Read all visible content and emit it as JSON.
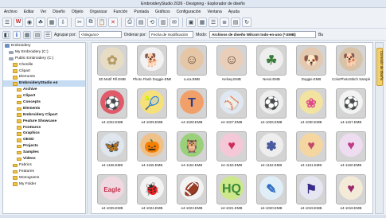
{
  "window": {
    "title": "EmbroideryStudio 2026 - Designing - Explorador de diseño"
  },
  "menu": [
    "Archivo",
    "Editar",
    "Ver",
    "Diseño",
    "Objeto",
    "Organizar",
    "Función",
    "Puntada",
    "Gráficos",
    "Configuración",
    "Ventana",
    "Ayuda"
  ],
  "toolbar2": {
    "group_label": "Agrupar por:",
    "group_value": "<Ninguno>",
    "order_label": "Ordenar por:",
    "order_value": "Fecha de modificación",
    "mode_label": "Modo:",
    "filter_value": "Archivos de diseño Wilcom todo-en-uno (*.EMB)",
    "size_label": "Bu"
  },
  "tree": [
    {
      "label": "Embroidery",
      "indent": 0,
      "icon": "lib",
      "bold": false,
      "selected": false
    },
    {
      "label": "My Embroidery (C:)",
      "indent": 1,
      "icon": "drive",
      "bold": false,
      "selected": false
    },
    {
      "label": "Public Embroidery (C:)",
      "indent": 1,
      "icon": "drive",
      "bold": false,
      "selected": false
    },
    {
      "label": "Chenille",
      "indent": 2,
      "icon": "folder",
      "bold": false,
      "selected": false
    },
    {
      "label": "Clipart",
      "indent": 2,
      "icon": "folder",
      "bold": false,
      "selected": false
    },
    {
      "label": "Elements",
      "indent": 2,
      "icon": "folder",
      "bold": false,
      "selected": false
    },
    {
      "label": "EmbroideryStudio e4",
      "indent": 2,
      "icon": "folder",
      "bold": true,
      "selected": true
    },
    {
      "label": "Archive",
      "indent": 3,
      "icon": "folder",
      "bold": true,
      "selected": false
    },
    {
      "label": "Clipart",
      "indent": 3,
      "icon": "folder",
      "bold": true,
      "selected": false
    },
    {
      "label": "Concepts",
      "indent": 3,
      "icon": "folder",
      "bold": true,
      "selected": false
    },
    {
      "label": "Elements",
      "indent": 3,
      "icon": "folder",
      "bold": true,
      "selected": false
    },
    {
      "label": "Embroidery Clipart",
      "indent": 3,
      "icon": "folder",
      "bold": true,
      "selected": false
    },
    {
      "label": "Feature Showcase",
      "indent": 3,
      "icon": "folder",
      "bold": true,
      "selected": false
    },
    {
      "label": "Fonttarns",
      "indent": 3,
      "icon": "folder",
      "bold": true,
      "selected": false
    },
    {
      "label": "Graphics",
      "indent": 3,
      "icon": "folder",
      "bold": true,
      "selected": false
    },
    {
      "label": "OESD",
      "indent": 3,
      "icon": "folder",
      "bold": true,
      "selected": false
    },
    {
      "label": "Projects",
      "indent": 3,
      "icon": "folder",
      "bold": true,
      "selected": false
    },
    {
      "label": "Samples",
      "indent": 3,
      "icon": "folder",
      "bold": true,
      "selected": false
    },
    {
      "label": "Videos",
      "indent": 3,
      "icon": "folder",
      "bold": true,
      "selected": false
    },
    {
      "label": "Fabrics",
      "indent": 2,
      "icon": "folder",
      "bold": false,
      "selected": false
    },
    {
      "label": "Features",
      "indent": 2,
      "icon": "folder",
      "bold": false,
      "selected": false
    },
    {
      "label": "Monograms",
      "indent": 2,
      "icon": "folder",
      "bold": false,
      "selected": false
    },
    {
      "label": "My Folder",
      "indent": 2,
      "icon": "folder",
      "bold": false,
      "selected": false
    }
  ],
  "thumbnails": [
    {
      "caption": "3D Motif Fill.EMB",
      "color": "#e7dcc4",
      "accent": "#b69c68",
      "glyph": "✿"
    },
    {
      "caption": "Photo Flash Doggie.EMB",
      "color": "#f2f2f2",
      "accent": "#8b5a3c",
      "glyph": "🐕"
    },
    {
      "caption": "Luca.EMB",
      "color": "#e5c7a8",
      "accent": "#6b4a2f",
      "glyph": "☺"
    },
    {
      "caption": "Kelsey.EMB",
      "color": "#e9cfb9",
      "accent": "#5a3b28",
      "glyph": "☺"
    },
    {
      "caption": "Nessi.EMB",
      "color": "#eeeeee",
      "accent": "#3a7d3a",
      "glyph": "☘"
    },
    {
      "caption": "Doggie.EMB",
      "color": "#e2c9b0",
      "accent": "#8a5a3a",
      "glyph": "🐶"
    },
    {
      "caption": "ColorPhotoStitch Sample.EMB",
      "color": "#d9c3a8",
      "accent": "#7c5536",
      "glyph": "🐕"
    },
    {
      "caption": "e4-1022.EMB",
      "color": "#e05a6a",
      "accent": "#2d7d3a",
      "glyph": "⚽"
    },
    {
      "caption": "e4-1029.EMB",
      "color": "#f6e07a",
      "accent": "#7a3a8a",
      "glyph": "🎾"
    },
    {
      "caption": "e4-1028.EMB",
      "color": "#f2a06a",
      "accent": "#2a3c8a",
      "glyph": "T"
    },
    {
      "caption": "e4-1027.EMB",
      "color": "#dfe8f2",
      "accent": "#7a1a2a",
      "glyph": "⚾"
    },
    {
      "caption": "e4-1026.EMB",
      "color": "#eeeeee",
      "accent": "#c02a2a",
      "glyph": "⚽"
    },
    {
      "caption": "e4-1030.EMB",
      "color": "#f3e3a0",
      "accent": "#e04a8a",
      "glyph": "❀"
    },
    {
      "caption": "e4-1157.EMB",
      "color": "#f3f3f3",
      "accent": "#d03030",
      "glyph": "⚽"
    },
    {
      "caption": "e4-1156.EMB",
      "color": "#dfe6ee",
      "accent": "#5a6a8a",
      "glyph": "🦋"
    },
    {
      "caption": "e4-1155.EMB",
      "color": "#f0c089",
      "accent": "#e07020",
      "glyph": "🎃"
    },
    {
      "caption": "e4-1154.EMB",
      "color": "#9ad07a",
      "accent": "#d03a8a",
      "glyph": "🦉"
    },
    {
      "caption": "e4-1153.EMB",
      "color": "#f5c8d8",
      "accent": "#d02a5a",
      "glyph": "♥"
    },
    {
      "caption": "e4-1152.EMB",
      "color": "#eeeeee",
      "accent": "#4a5aa0",
      "glyph": "✽"
    },
    {
      "caption": "e4-1151.EMB",
      "color": "#f6d6a0",
      "accent": "#c04a6a",
      "glyph": "♥"
    },
    {
      "caption": "e4-1150.EMB",
      "color": "#eedcf0",
      "accent": "#c03a8a",
      "glyph": "♥"
    },
    {
      "caption": "e4-1025.EMB",
      "color": "#f0d8e0",
      "accent": "#c0304a",
      "glyph": "Eagle"
    },
    {
      "caption": "e4-1024.EMB",
      "color": "#f3f3f3",
      "accent": "#d04a2a",
      "glyph": "🐞"
    },
    {
      "caption": "e4-1023.EMB",
      "color": "#f3f3f3",
      "accent": "#c02a2a",
      "glyph": "🏈"
    },
    {
      "caption": "e4-1021.EMB",
      "color": "#cde88a",
      "accent": "#3a8a3a",
      "glyph": "HQ"
    },
    {
      "caption": "e4-1020.EMB",
      "color": "#e0eef8",
      "accent": "#2a6ac0",
      "glyph": "✎"
    },
    {
      "caption": "e4-1019.EMB",
      "color": "#e6e6f2",
      "accent": "#3a2a8a",
      "glyph": "⚑"
    },
    {
      "caption": "e4-1018.EMB",
      "color": "#f3ead8",
      "accent": "#9a2a6a",
      "glyph": "♥"
    }
  ]
}
